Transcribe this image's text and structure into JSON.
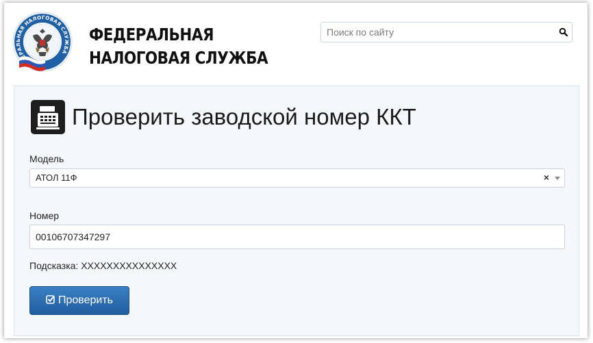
{
  "header": {
    "emblem_text": "ФЕДЕРАЛЬНАЯ НАЛОГОВАЯ СЛУЖБА",
    "brand_line1": "ФЕДЕРАЛЬНАЯ",
    "brand_line2": "НАЛОГОВАЯ СЛУЖБА",
    "search_placeholder": "Поиск по сайту",
    "search_value": ""
  },
  "form": {
    "title": "Проверить заводской номер ККТ",
    "model_label": "Модель",
    "model_value": "АТОЛ 11Ф",
    "model_clear": "×",
    "number_label": "Номер",
    "number_value": "00106707347297",
    "hint": "Подсказка: XXXXXXXXXXXXXXX",
    "submit_label": "Проверить"
  },
  "icons": {
    "search": "search-icon",
    "cash_register": "cash-register-icon",
    "check": "check-square-icon",
    "caret": "chevron-down-icon"
  },
  "colors": {
    "button": "#2a6cb0",
    "panel_bg": "#f4f8fb",
    "emblem_blue": "#1f5fa6"
  }
}
